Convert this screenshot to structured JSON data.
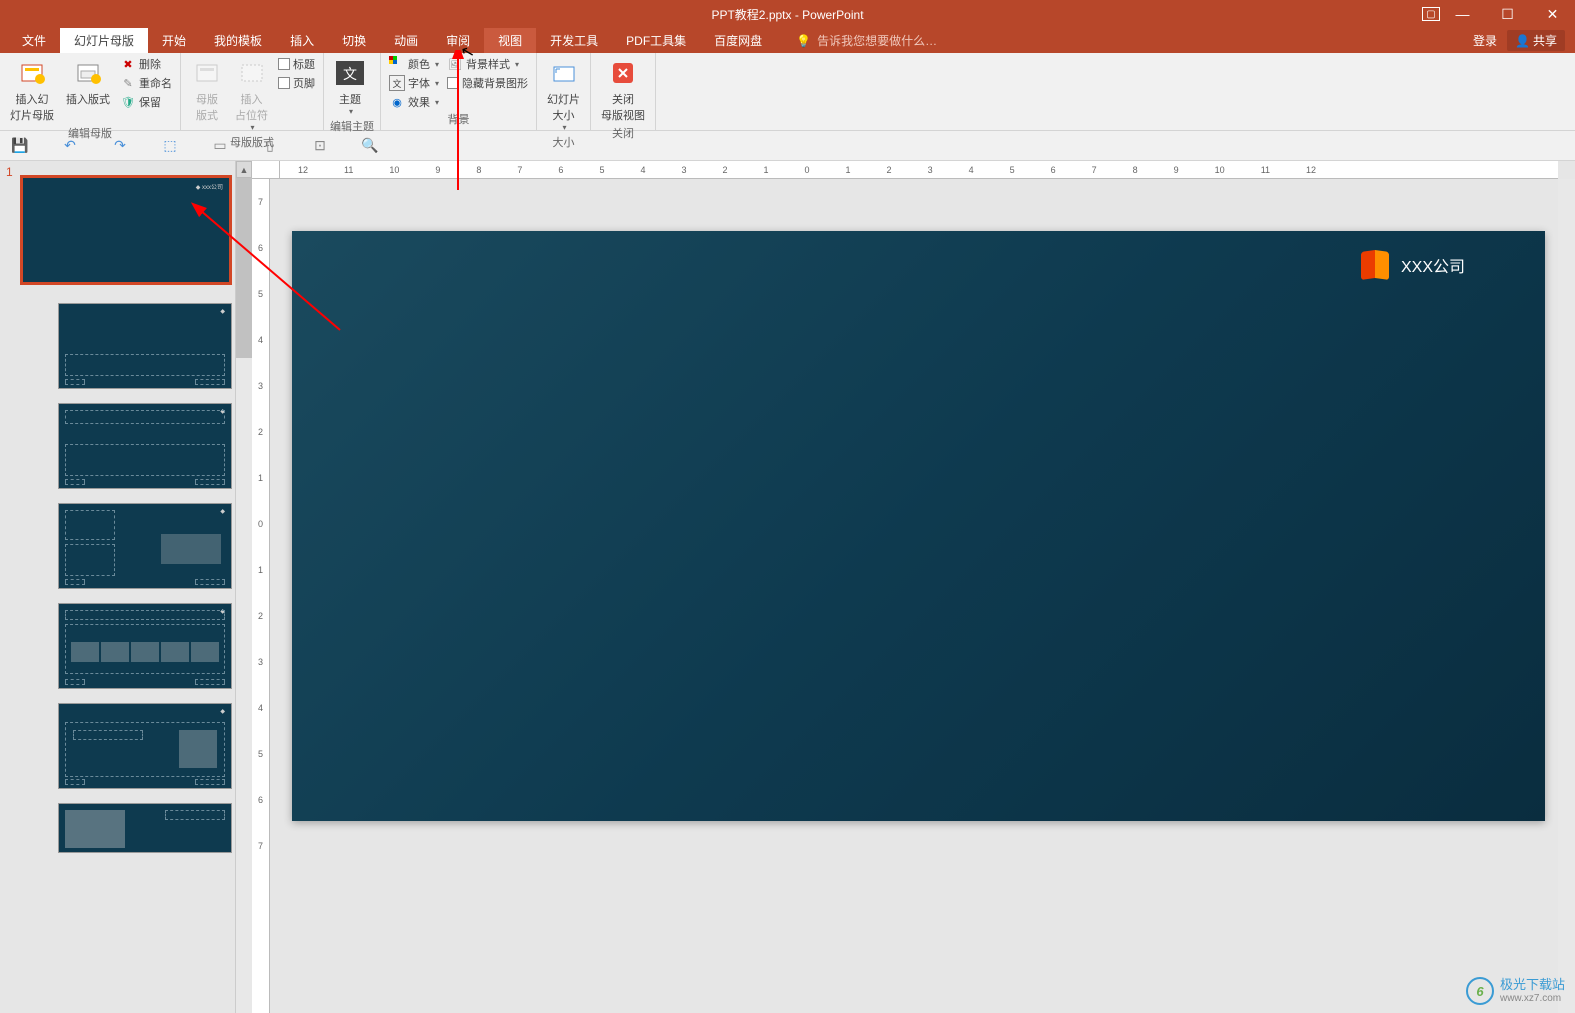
{
  "window": {
    "title": "PPT教程2.pptx - PowerPoint"
  },
  "tabs": {
    "file": "文件",
    "slide_master": "幻灯片母版",
    "home": "开始",
    "my_templates": "我的模板",
    "insert": "插入",
    "transitions": "切换",
    "animations": "动画",
    "review": "审阅",
    "view": "视图",
    "developer": "开发工具",
    "pdf_tools": "PDF工具集",
    "baidu_disk": "百度网盘",
    "tell_me": "告诉我您想要做什么…",
    "login": "登录",
    "share": "共享"
  },
  "ribbon": {
    "group1": {
      "label": "编辑母版",
      "insert_slide_master": "插入幻\n灯片母版",
      "insert_layout": "插入版式",
      "delete": "删除",
      "rename": "重命名",
      "preserve": "保留"
    },
    "group2": {
      "label": "母版版式",
      "master_layout": "母版\n版式",
      "insert_placeholder": "插入\n占位符",
      "title": "标题",
      "footers": "页脚"
    },
    "group3": {
      "label": "编辑主题",
      "themes": "主题"
    },
    "group4": {
      "label": "背景",
      "colors": "颜色",
      "fonts": "字体",
      "effects": "效果",
      "bg_styles": "背景样式",
      "hide_bg_graphics": "隐藏背景图形"
    },
    "group5": {
      "label": "大小",
      "slide_size": "幻灯片\n大小"
    },
    "group6": {
      "label": "关闭",
      "close_master": "关闭\n母版视图"
    }
  },
  "ruler_h": [
    "12",
    "11",
    "10",
    "9",
    "8",
    "7",
    "6",
    "5",
    "4",
    "3",
    "2",
    "1",
    "0",
    "1",
    "2",
    "3",
    "4",
    "5",
    "6",
    "7",
    "8",
    "9",
    "10",
    "11",
    "12"
  ],
  "ruler_v": [
    "7",
    "6",
    "5",
    "4",
    "3",
    "2",
    "1",
    "0",
    "1",
    "2",
    "3",
    "4",
    "5",
    "6",
    "7"
  ],
  "slide": {
    "company": "XXX公司"
  },
  "thumbnails": {
    "master_num": "1"
  },
  "watermark": {
    "name": "极光下载站",
    "url": "www.xz7.com"
  },
  "tell_me_icon": "💡"
}
